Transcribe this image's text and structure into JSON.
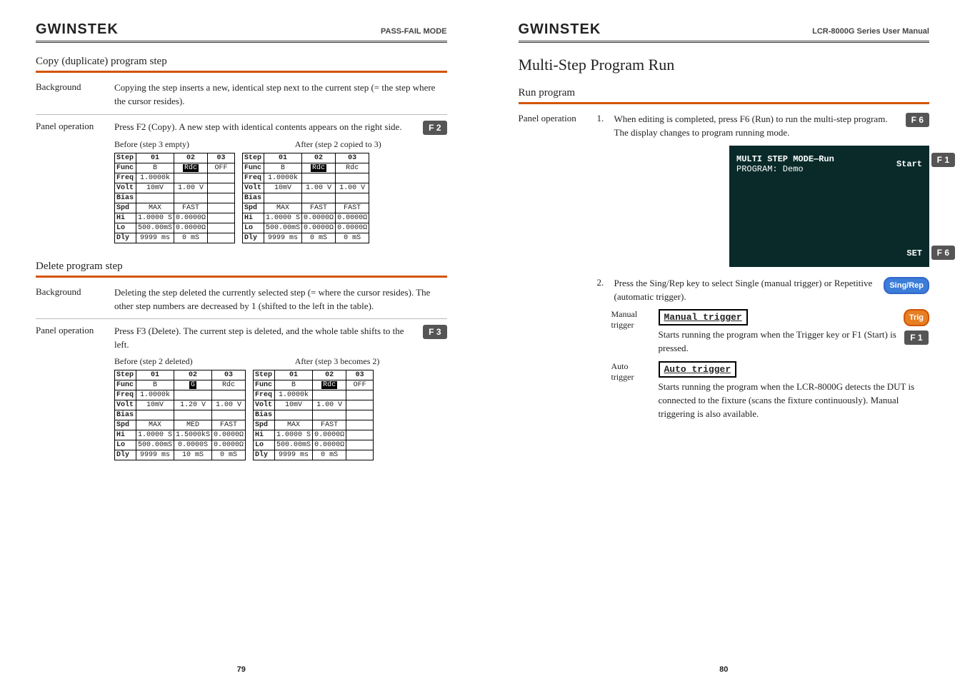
{
  "left": {
    "logo": "GWINSTEK",
    "header_title": "PASS-FAIL MODE",
    "page_num": "79",
    "copy": {
      "title": "Copy (duplicate) program step",
      "bg_label": "Background",
      "bg_text": "Copying the step inserts a new, identical step next to the current step (= the step where the cursor resides).",
      "op_label": "Panel operation",
      "op_text": "Press F2 (Copy). A new step with identical contents appears on the right side.",
      "fkey": "F 2",
      "before_cap": "Before (step 3 empty)",
      "after_cap": "After (step 2 copied to 3)",
      "tables": {
        "rows": [
          "Step",
          "Func",
          "Freq",
          "Volt",
          "Bias",
          "Spd",
          "Hi",
          "Lo",
          "Dly"
        ],
        "before": {
          "c1": [
            "01",
            "B",
            "1.0000k",
            "10mV",
            "",
            "MAX",
            "1.0000 S",
            "500.00mS",
            "9999 ms"
          ],
          "c2": [
            "02",
            "Rdc",
            "",
            "1.00 V",
            "",
            "FAST",
            "0.0000Ω",
            "0.0000Ω",
            "0 mS"
          ],
          "c3": [
            "03",
            "OFF",
            "",
            "",
            "",
            "",
            "",
            "",
            ""
          ]
        },
        "after": {
          "c1": [
            "01",
            "B",
            "1.0000k",
            "10mV",
            "",
            "MAX",
            "1.0000 S",
            "500.00mS",
            "9999 ms"
          ],
          "c2": [
            "02",
            "Rdc",
            "",
            "1.00 V",
            "",
            "FAST",
            "0.0000Ω",
            "0.0000Ω",
            "0 mS"
          ],
          "c3": [
            "03",
            "Rdc",
            "",
            "1.00 V",
            "",
            "FAST",
            "0.0000Ω",
            "0.0000Ω",
            "0 mS"
          ]
        }
      }
    },
    "del": {
      "title": "Delete program step",
      "bg_label": "Background",
      "bg_text": "Deleting the step deleted the currently selected step (= where the cursor resides). The other step numbers are decreased by 1 (shifted to the left in the table).",
      "op_label": "Panel operation",
      "op_text": "Press F3 (Delete). The current step is deleted, and the whole table shifts to the left.",
      "fkey": "F 3",
      "before_cap": "Before (step 2 deleted)",
      "after_cap": "After (step 3 becomes 2)",
      "tables": {
        "rows": [
          "Step",
          "Func",
          "Freq",
          "Volt",
          "Bias",
          "Spd",
          "Hi",
          "Lo",
          "Dly"
        ],
        "before": {
          "c1": [
            "01",
            "B",
            "1.0000k",
            "10mV",
            "",
            "MAX",
            "1.0000 S",
            "500.00mS",
            "9999 ms"
          ],
          "c2": [
            "02",
            "G",
            "",
            "1.20 V",
            "",
            "MED",
            "1.5000kS",
            "0.0000S",
            "10 mS"
          ],
          "c3": [
            "03",
            "Rdc",
            "",
            "1.00 V",
            "",
            "FAST",
            "0.0000Ω",
            "0.0000Ω",
            "0 mS"
          ]
        },
        "after": {
          "c1": [
            "01",
            "B",
            "1.0000k",
            "10mV",
            "",
            "MAX",
            "1.0000 S",
            "500.00mS",
            "9999 ms"
          ],
          "c2": [
            "02",
            "Rdc",
            "",
            "1.00 V",
            "",
            "FAST",
            "0.0000Ω",
            "0.0000Ω",
            "0 mS"
          ],
          "c3": [
            "03",
            "OFF",
            "",
            "",
            "",
            "",
            "",
            "",
            ""
          ]
        }
      }
    }
  },
  "right": {
    "logo": "GWINSTEK",
    "header_title": "LCR-8000G Series User Manual",
    "page_num": "80",
    "h1": "Multi-Step Program Run",
    "run_title": "Run program",
    "op_label": "Panel operation",
    "step1_num": "1.",
    "step1_text": "When editing is completed, press F6 (Run) to run the multi-step program. The display changes to program running mode.",
    "step1_fkey": "F 6",
    "lcd_title": "MULTI STEP MODE—Run",
    "lcd_program": "PROGRAM: Demo",
    "lcd_start": "Start",
    "lcd_set": "SET",
    "lcd_f1": "F 1",
    "lcd_f6": "F 6",
    "step2_num": "2.",
    "step2_text": "Press the Sing/Rep key to select Single (manual trigger) or Repetitive (automatic trigger).",
    "sing_rep": "Sing/Rep",
    "manual_label": "Manual trigger",
    "manual_title": "Manual trigger",
    "manual_text": "Starts running the program when the Trigger key or F1 (Start) is pressed.",
    "trig_key": "Trig",
    "trig_f1": "F 1",
    "auto_label": "Auto trigger",
    "auto_title": "Auto trigger",
    "auto_text": "Starts running the program when the LCR-8000G detects the DUT is connected to the fixture (scans the fixture continuously). Manual triggering is also available."
  }
}
